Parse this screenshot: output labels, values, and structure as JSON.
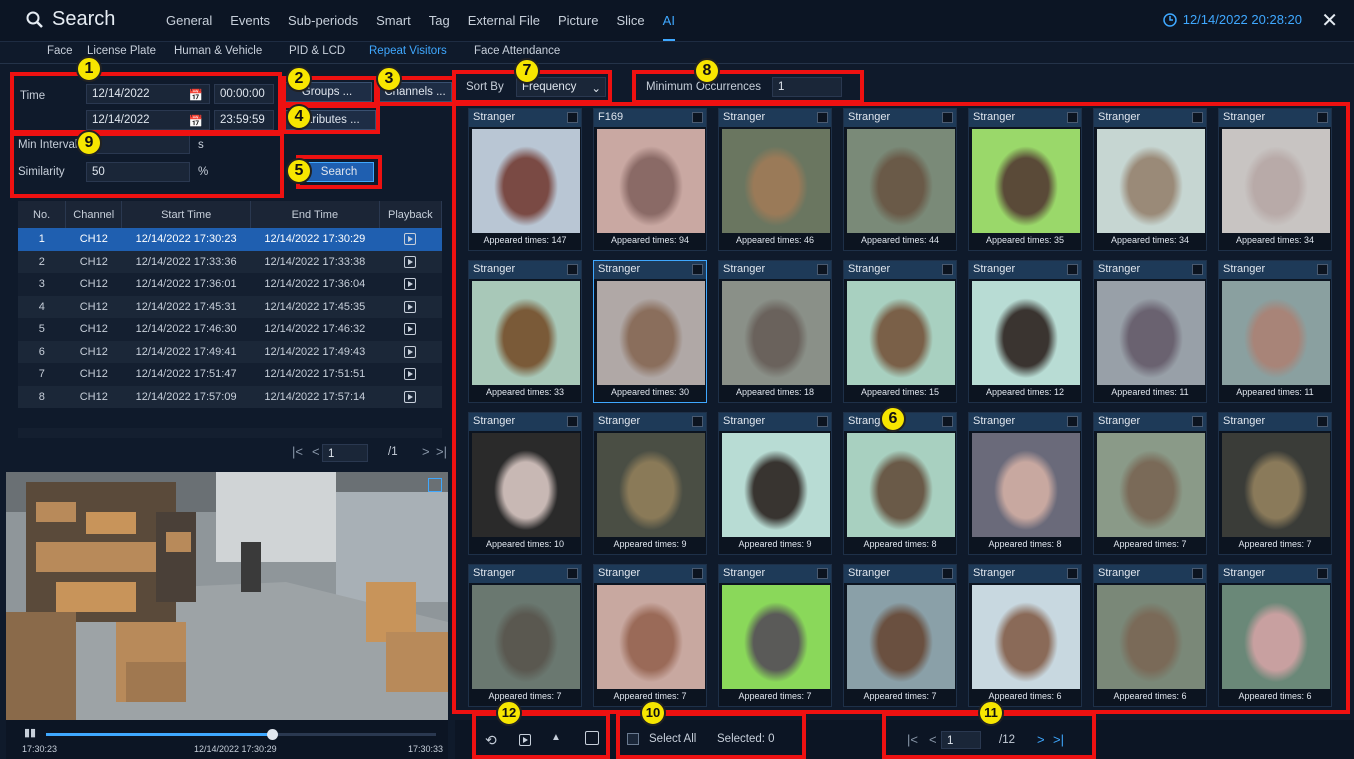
{
  "header": {
    "title": "Search",
    "menu": [
      "General",
      "Events",
      "Sub-periods",
      "Smart",
      "Tag",
      "External File",
      "Picture",
      "Slice",
      "AI"
    ],
    "active_menu": "AI",
    "datetime": "12/14/2022 20:28:20"
  },
  "subtabs": {
    "items": [
      "Face",
      "License Plate",
      "Human & Vehicle",
      "PID & LCD",
      "Repeat Visitors",
      "Face Attendance"
    ],
    "active": "Repeat Visitors"
  },
  "form": {
    "time_label": "Time",
    "start_date": "12/14/2022",
    "start_time": "00:00:00",
    "end_date": "12/14/2022",
    "end_time": "23:59:59",
    "groups_btn": "Groups ...",
    "channels_btn": "Channels ...",
    "attributes_btn": "Attributes ...",
    "min_interval_label": "Min Interval",
    "min_interval_unit": "s",
    "similarity_label": "Similarity",
    "similarity_value": "50",
    "similarity_unit": "%",
    "search_btn": "Search"
  },
  "table": {
    "headers": [
      "No.",
      "Channel",
      "Start Time",
      "End Time",
      "Playback"
    ],
    "rows": [
      [
        "1",
        "CH12",
        "12/14/2022 17:30:23",
        "12/14/2022 17:30:29"
      ],
      [
        "2",
        "CH12",
        "12/14/2022 17:33:36",
        "12/14/2022 17:33:38"
      ],
      [
        "3",
        "CH12",
        "12/14/2022 17:36:01",
        "12/14/2022 17:36:04"
      ],
      [
        "4",
        "CH12",
        "12/14/2022 17:45:31",
        "12/14/2022 17:45:35"
      ],
      [
        "5",
        "CH12",
        "12/14/2022 17:46:30",
        "12/14/2022 17:46:32"
      ],
      [
        "6",
        "CH12",
        "12/14/2022 17:49:41",
        "12/14/2022 17:49:43"
      ],
      [
        "7",
        "CH12",
        "12/14/2022 17:51:47",
        "12/14/2022 17:51:51"
      ],
      [
        "8",
        "CH12",
        "12/14/2022 17:57:09",
        "12/14/2022 17:57:14"
      ]
    ],
    "page": "1",
    "total": "/1"
  },
  "video": {
    "progress": 0.58,
    "start": "17:30:23",
    "current": "12/14/2022 17:30:29",
    "end": "17:30:33"
  },
  "sort": {
    "label": "Sort By",
    "value": "Frequency"
  },
  "min_occ": {
    "label": "Minimum Occurrences",
    "value": "1"
  },
  "grid": {
    "cards": [
      {
        "name": "Stranger",
        "times": "Appeared times: 147",
        "bg": "#b9c6d4",
        "face": "#7a4a44"
      },
      {
        "name": "F169",
        "times": "Appeared times: 94",
        "bg": "#c9a8a2",
        "face": "#8a6a66"
      },
      {
        "name": "Stranger",
        "times": "Appeared times: 46",
        "bg": "#6a7660",
        "face": "#9a7a58"
      },
      {
        "name": "Stranger",
        "times": "Appeared times: 44",
        "bg": "#7a8a78",
        "face": "#6a5a48"
      },
      {
        "name": "Stranger",
        "times": "Appeared times: 35",
        "bg": "#9ad86a",
        "face": "#5a4a38"
      },
      {
        "name": "Stranger",
        "times": "Appeared times: 34",
        "bg": "#c6d6d2",
        "face": "#9a8a78"
      },
      {
        "name": "Stranger",
        "times": "Appeared times: 34",
        "bg": "#c8c4c2",
        "face": "#b8aaa8"
      },
      {
        "name": "Stranger",
        "times": "Appeared times: 33",
        "bg": "#a8c8b8",
        "face": "#7a5a38"
      },
      {
        "name": "Stranger",
        "times": "Appeared times: 30",
        "bg": "#b0a8a6",
        "face": "#8a6e5c"
      },
      {
        "name": "Stranger",
        "times": "Appeared times: 18",
        "bg": "#8a9088",
        "face": "#6a625c"
      },
      {
        "name": "Stranger",
        "times": "Appeared times: 15",
        "bg": "#a8d0c0",
        "face": "#7a6048"
      },
      {
        "name": "Stranger",
        "times": "Appeared times: 12",
        "bg": "#b8dcd4",
        "face": "#3a3430"
      },
      {
        "name": "Stranger",
        "times": "Appeared times: 11",
        "bg": "#98a0a8",
        "face": "#6a6270"
      },
      {
        "name": "Stranger",
        "times": "Appeared times: 11",
        "bg": "#8aa0a0",
        "face": "#a88478"
      },
      {
        "name": "Stranger",
        "times": "Appeared times: 10",
        "bg": "#2a2a2a",
        "face": "#c8b8b4"
      },
      {
        "name": "Stranger",
        "times": "Appeared times: 9",
        "bg": "#4a4e44",
        "face": "#8a7a58"
      },
      {
        "name": "Stranger",
        "times": "Appeared times: 9",
        "bg": "#b8dcd4",
        "face": "#383430"
      },
      {
        "name": "Stranger",
        "times": "Appeared times: 8",
        "bg": "#a8d0c0",
        "face": "#6a5a48"
      },
      {
        "name": "Stranger",
        "times": "Appeared times: 8",
        "bg": "#6a6a7a",
        "face": "#c8a8a0"
      },
      {
        "name": "Stranger",
        "times": "Appeared times: 7",
        "bg": "#8a9a88",
        "face": "#7a6a58"
      },
      {
        "name": "Stranger",
        "times": "Appeared times: 7",
        "bg": "#3a3c38",
        "face": "#8a7a5a"
      },
      {
        "name": "Stranger",
        "times": "Appeared times: 7",
        "bg": "#6a7870",
        "face": "#5a5850"
      },
      {
        "name": "Stranger",
        "times": "Appeared times: 7",
        "bg": "#c8a8a0",
        "face": "#9a6a58"
      },
      {
        "name": "Stranger",
        "times": "Appeared times: 7",
        "bg": "#8ad85a",
        "face": "#5a5a58"
      },
      {
        "name": "Stranger",
        "times": "Appeared times: 7",
        "bg": "#8aa0a8",
        "face": "#6a5040"
      },
      {
        "name": "Stranger",
        "times": "Appeared times: 6",
        "bg": "#c8d8e0",
        "face": "#8a6a58"
      },
      {
        "name": "Stranger",
        "times": "Appeared times: 6",
        "bg": "#7a8878",
        "face": "#7a6a58"
      },
      {
        "name": "Stranger",
        "times": "Appeared times: 6",
        "bg": "#6a8878",
        "face": "#c8a0a0"
      }
    ]
  },
  "bottom": {
    "select_all": "Select All",
    "selected": "Selected: 0",
    "page": "1",
    "total": "/12"
  },
  "badges": [
    "1",
    "2",
    "3",
    "4",
    "5",
    "6",
    "7",
    "8",
    "9",
    "10",
    "11",
    "12"
  ]
}
